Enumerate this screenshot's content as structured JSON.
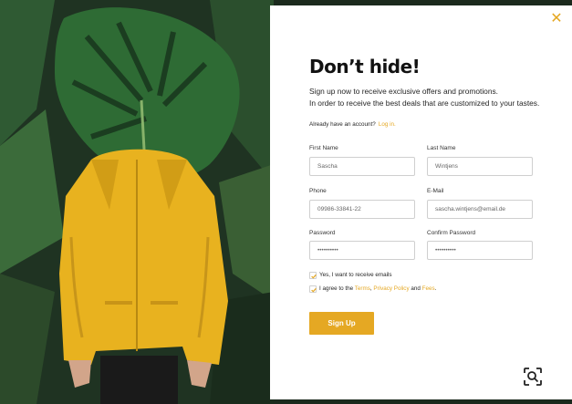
{
  "modal": {
    "title": "Don’t hide!",
    "subtitle_line1": "Sign up now to receive exclusive offers and promotions.",
    "subtitle_line2": "In order to receive the best deals that are customized to your tastes.",
    "have_account": "Already have an account?",
    "login_link": "Log in.",
    "close_icon": "close-icon"
  },
  "form": {
    "first_name": {
      "label": "First Name",
      "value": "Sascha"
    },
    "last_name": {
      "label": "Last Name",
      "value": "Wintjens"
    },
    "phone": {
      "label": "Phone",
      "value": "09986-33841-22"
    },
    "email": {
      "label": "E-Mail",
      "value": "sascha.wintjens@email.de"
    },
    "password": {
      "label": "Password",
      "value": "••••••••••"
    },
    "confirm_password": {
      "label": "Confirm Password",
      "value": "••••••••••"
    }
  },
  "consent": {
    "emails_label": "Yes, I want to receive emails",
    "emails_checked": true,
    "agree_prefix": "I agree to the",
    "terms": "Terms",
    "comma": ",",
    "privacy": "Privacy Policy",
    "and": "and",
    "fees": "Fees",
    "period": ".",
    "agree_checked": true
  },
  "actions": {
    "signup_label": "Sign Up"
  },
  "colors": {
    "accent": "#e5a823",
    "title": "#121212",
    "background": "#ffffff"
  },
  "overlay": {
    "lens_icon": "visual-search-icon"
  }
}
